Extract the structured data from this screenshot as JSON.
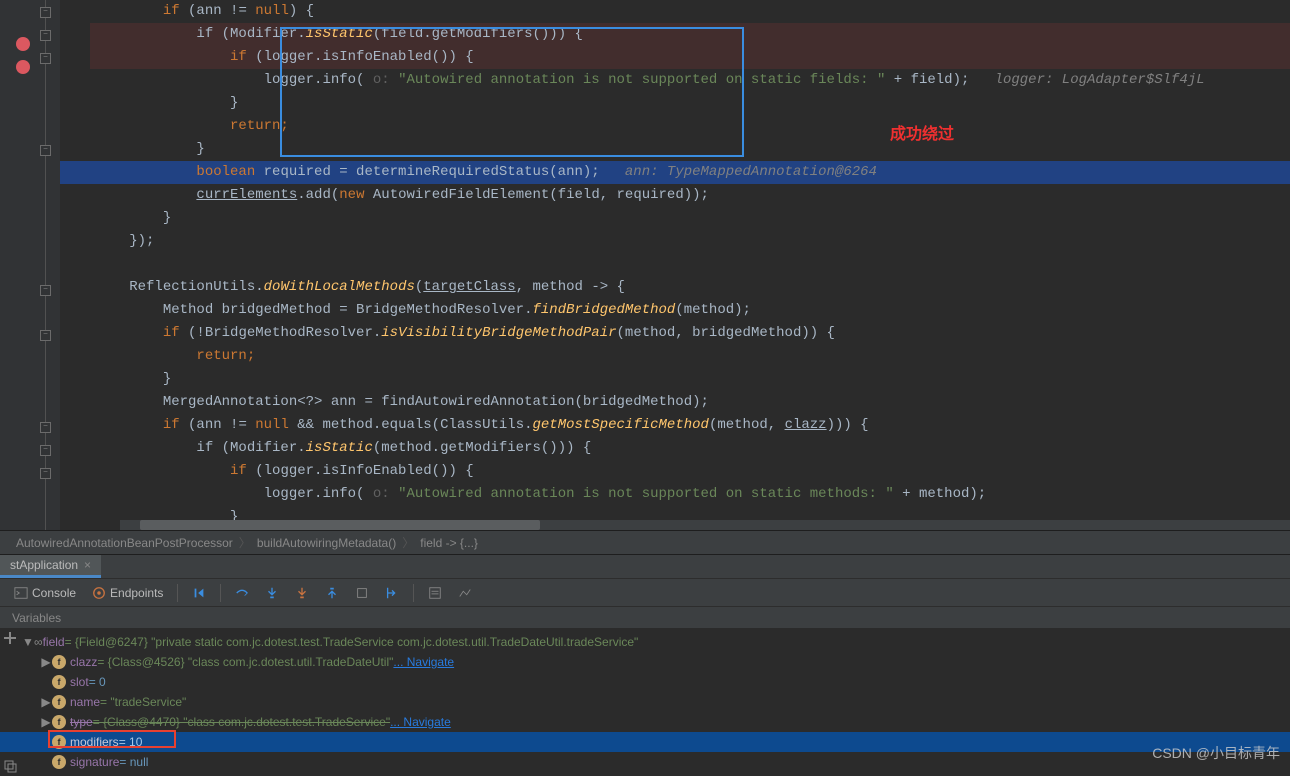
{
  "annotations": {
    "red_label": "成功绕过"
  },
  "code": {
    "line1": "            if (ann != null) {",
    "line2_pre": "                if (Modifier.",
    "line2_isStatic": "isStatic",
    "line2_post": "(field.getModifiers())) {",
    "line3_pre": "                    if (logger.isInfoEnabled()) {",
    "line4_pre": "                        logger.info( ",
    "line4_hint": "o: ",
    "line4_str": "\"Autowired annotation is not supported on static fields: \"",
    "line4_post": " + field);",
    "line4_comment": "   logger: LogAdapter$Slf4jL",
    "line5": "                    }",
    "line6_ret": "                    return;",
    "line7": "                }",
    "line8_kw": "                boolean",
    "line8_mid": " required = determineRequiredStatus(ann);",
    "line8_comment": "   ann: TypeMappedAnnotation@6264",
    "line9_pre": "                ",
    "line9_curr": "currElements",
    "line9_mid": ".add(",
    "line9_new": "new",
    "line9_post": " AutowiredFieldElement(field, required));",
    "line10": "            }",
    "line11": "        });",
    "line12": "",
    "line13_pre": "        ReflectionUtils.",
    "line13_method": "doWithLocalMethods",
    "line13_mid": "(",
    "line13_target": "targetClass",
    "line13_post": ", method -> {",
    "line14_pre": "            Method bridgedMethod = BridgeMethodResolver.",
    "line14_method": "findBridgedMethod",
    "line14_post": "(method);",
    "line15_pre": "            if (!BridgeMethodResolver.",
    "line15_method": "isVisibilityBridgeMethodPair",
    "line15_post": "(method, bridgedMethod)) {",
    "line16_ret": "                return;",
    "line17": "            }",
    "line18_pre": "            MergedAnnotation<?> ann = findAutowiredAnnotation(bridgedMethod);",
    "line19_pre": "            if (ann != ",
    "line19_null": "null",
    "line19_mid": " && method.equals(ClassUtils.",
    "line19_method": "getMostSpecificMethod",
    "line19_mid2": "(method, ",
    "line19_clazz": "clazz",
    "line19_post": "))) {",
    "line20_pre": "                if (Modifier.",
    "line20_isStatic": "isStatic",
    "line20_post": "(method.getModifiers())) {",
    "line21": "                    if (logger.isInfoEnabled()) {",
    "line22_pre": "                        logger.info( ",
    "line22_hint": "o: ",
    "line22_str": "\"Autowired annotation is not supported on static methods: \"",
    "line22_post": " + method);",
    "line23": "                    }"
  },
  "breadcrumb": {
    "c1": "AutowiredAnnotationBeanPostProcessor",
    "c2": "buildAutowiringMetadata()",
    "c3": "field -> {...}"
  },
  "debug_tab": "stApplication",
  "toolbar": {
    "console": "Console",
    "endpoints": "Endpoints"
  },
  "variables_header": "Variables",
  "vars": {
    "field_name": "field",
    "field_val": " = {Field@6247} \"private static com.jc.dotest.test.TradeService com.jc.dotest.util.TradeDateUtil.tradeService\"",
    "clazz_name": "clazz",
    "clazz_val": " = {Class@4526} \"class com.jc.dotest.util.TradeDateUtil\"",
    "clazz_link": " ... Navigate",
    "slot_name": "slot",
    "slot_val": " = 0",
    "name_name": "name",
    "name_val": " = \"tradeService\"",
    "type_name": "type",
    "type_val": " = {Class@4470} \"class com.jc.dotest.test.TradeService\"",
    "type_link": " ... Navigate",
    "modifiers_name": "modifiers",
    "modifiers_val": " = 10",
    "signature_name": "signature",
    "signature_val": " = null"
  },
  "watermark": "CSDN @小目标青年"
}
